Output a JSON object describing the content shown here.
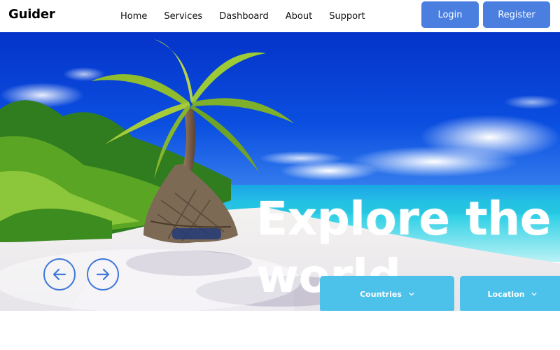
{
  "brand": {
    "name": "Guider"
  },
  "nav": {
    "items": [
      {
        "label": "Home"
      },
      {
        "label": "Services"
      },
      {
        "label": "Dashboard"
      },
      {
        "label": "About"
      },
      {
        "label": "Support"
      }
    ]
  },
  "auth": {
    "login_label": "Login",
    "register_label": "Register"
  },
  "hero": {
    "title_line1": "Explore the",
    "title_line2": "world",
    "prev_icon": "arrow-left-circle-icon",
    "next_icon": "arrow-right-circle-icon",
    "filters": [
      {
        "label": "Countries",
        "icon": "chevron-down-icon"
      },
      {
        "label": "Location",
        "icon": "chevron-down-icon"
      }
    ]
  },
  "colors": {
    "button_blue": "#4a7fe0",
    "filter_blue": "#4cc1ea",
    "arrow_blue": "#3f78d9",
    "sky": "#0a45d6",
    "sea": "#2fd0e6"
  }
}
